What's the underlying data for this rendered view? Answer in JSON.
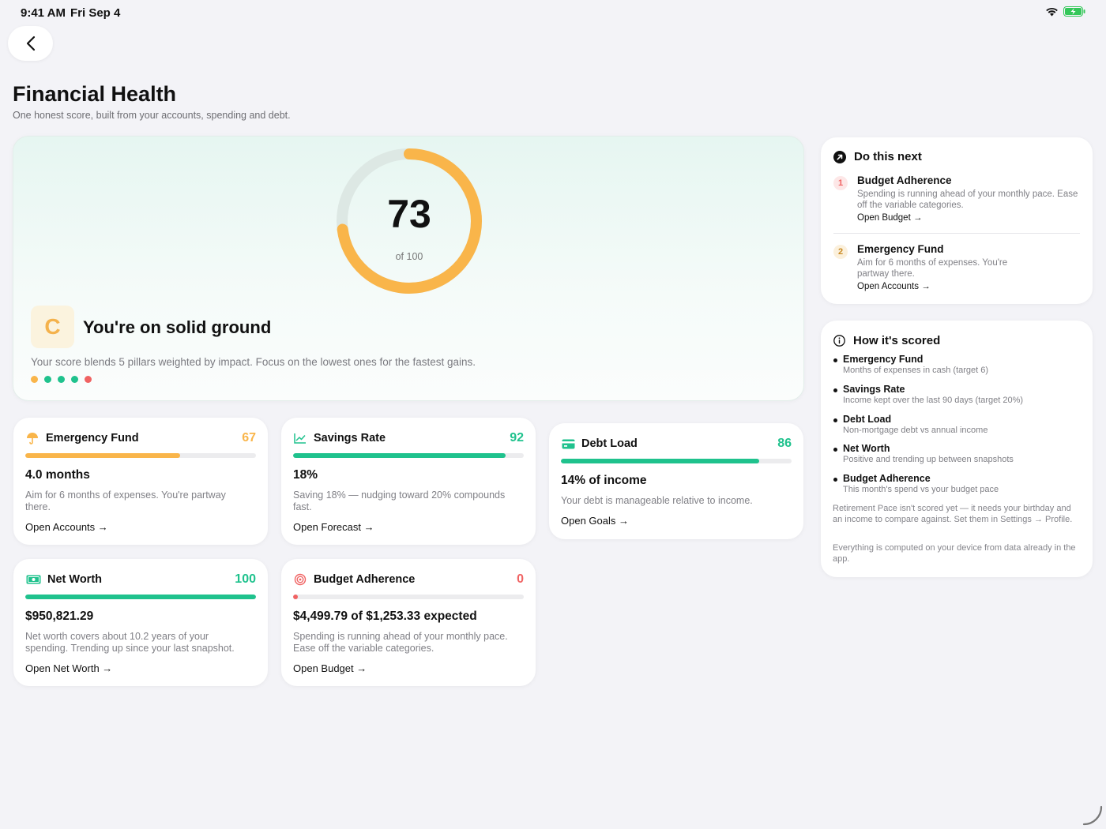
{
  "status_bar": {
    "time": "9:41 AM",
    "date": "Fri Sep 4"
  },
  "header": {
    "title": "Financial Health",
    "subtitle": "One honest score, built from your accounts, spending and debt."
  },
  "hero": {
    "score": "73",
    "score_value": 73,
    "score_max_label": "of 100",
    "grade": "C",
    "headline": "You're on solid ground",
    "description": "Your score blends 5 pillars weighted by impact. Focus on the lowest ones for the fastest gains.",
    "ring_color": "#f9b54a",
    "track_color": "#dde8e4",
    "pillar_dots": [
      "#f9b54a",
      "#1fc28d",
      "#1fc28d",
      "#1fc28d",
      "#f06262"
    ]
  },
  "pillars": [
    {
      "title": "Emergency Fund",
      "score": "67",
      "score_value": 67,
      "color": "#f9b54a",
      "icon": "umbrella-icon",
      "value": "4.0 months",
      "description": "Aim for 6 months of expenses. You're partway there.",
      "link": "Open Accounts →"
    },
    {
      "title": "Savings Rate",
      "score": "92",
      "score_value": 92,
      "color": "#1fc28d",
      "icon": "trend-chart-icon",
      "value": "18%",
      "description": "Saving 18% — nudging toward 20% compounds fast.",
      "link": "Open Forecast →"
    },
    {
      "title": "Debt Load",
      "score": "86",
      "score_value": 86,
      "color": "#1fc28d",
      "icon": "credit-card-icon",
      "value": "14% of income",
      "description": "Your debt is manageable relative to income.",
      "link": "Open Goals →"
    },
    {
      "title": "Net Worth",
      "score": "100",
      "score_value": 100,
      "color": "#1fc28d",
      "icon": "banknote-icon",
      "value": "$950,821.29",
      "description": "Net worth covers about 10.2 years of your spending. Trending up since your last snapshot.",
      "link": "Open Net Worth →"
    },
    {
      "title": "Budget Adherence",
      "score": "0",
      "score_value": 0,
      "color": "#f06262",
      "icon": "target-icon",
      "value": "$4,499.79 of $1,253.33 expected",
      "description": "Spending is running ahead of your monthly pace. Ease off the variable categories.",
      "link": "Open Budget →"
    }
  ],
  "next_steps": {
    "title": "Do this next",
    "items": [
      {
        "num": "1",
        "title": "Budget Adherence",
        "description": "Spending is running ahead of your monthly pace. Ease off the variable categories.",
        "link": "Open Budget →",
        "num_color": "#f06262",
        "num_bg": "#fde7e7"
      },
      {
        "num": "2",
        "title": "Emergency Fund",
        "description": "Aim for 6 months of expenses. You're partway there.",
        "link": "Open Accounts →",
        "num_color": "#c98a23",
        "num_bg": "#fbf0dc"
      }
    ]
  },
  "scoring": {
    "title": "How it's scored",
    "items": [
      {
        "name": "Emergency Fund",
        "description": "Months of expenses in cash (target 6)"
      },
      {
        "name": "Savings Rate",
        "description": "Income kept over the last 90 days (target 20%)"
      },
      {
        "name": "Debt Load",
        "description": "Non-mortgage debt vs annual income"
      },
      {
        "name": "Net Worth",
        "description": "Positive and trending up between snapshots"
      },
      {
        "name": "Budget Adherence",
        "description": "This month's spend vs your budget pace"
      }
    ],
    "note_1": "Retirement Pace isn't scored yet — it needs your birthday and an income to compare against. Set them in Settings → Profile.",
    "note_2": "Everything is computed on your device from data already in the app."
  }
}
